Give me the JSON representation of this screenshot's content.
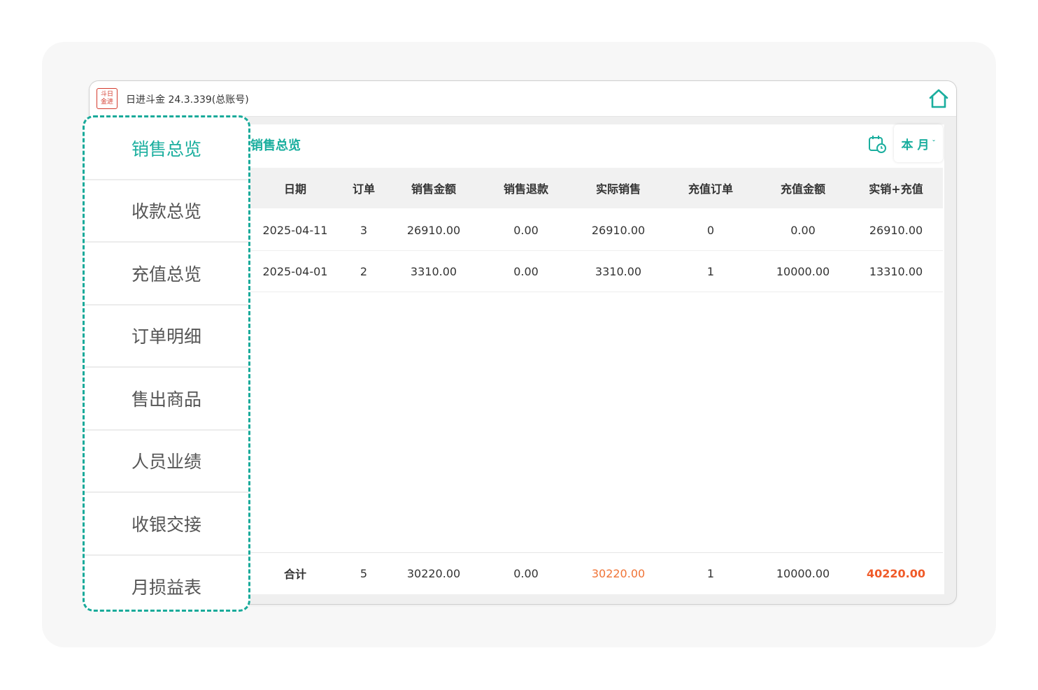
{
  "app": {
    "title": "日进斗金 24.3.339(总账号)",
    "logo_top": "斗日",
    "logo_bottom": "金进"
  },
  "colors": {
    "accent": "#1aae9e",
    "highlight": "#f07437"
  },
  "sidebar": {
    "items": [
      {
        "label": "销售总览",
        "active": true
      },
      {
        "label": "收款总览",
        "active": false
      },
      {
        "label": "充值总览",
        "active": false
      },
      {
        "label": "订单明细",
        "active": false
      },
      {
        "label": "售出商品",
        "active": false
      },
      {
        "label": "人员业绩",
        "active": false
      },
      {
        "label": "收银交接",
        "active": false
      },
      {
        "label": "月损益表",
        "active": false
      }
    ]
  },
  "panel": {
    "title": "销售总览",
    "period": "本 月",
    "period_caret": "ˇ",
    "calendar_icon": "calendar-clock-icon"
  },
  "table": {
    "columns": [
      "日期",
      "订单",
      "销售金额",
      "销售退款",
      "实际销售",
      "充值订单",
      "充值金额",
      "实销+充值"
    ],
    "rows": [
      [
        "2025-04-11",
        "3",
        "26910.00",
        "0.00",
        "26910.00",
        "0",
        "0.00",
        "26910.00"
      ],
      [
        "2025-04-01",
        "2",
        "3310.00",
        "0.00",
        "3310.00",
        "1",
        "10000.00",
        "13310.00"
      ]
    ],
    "total": [
      "合计",
      "5",
      "30220.00",
      "0.00",
      "30220.00",
      "1",
      "10000.00",
      "40220.00"
    ]
  }
}
